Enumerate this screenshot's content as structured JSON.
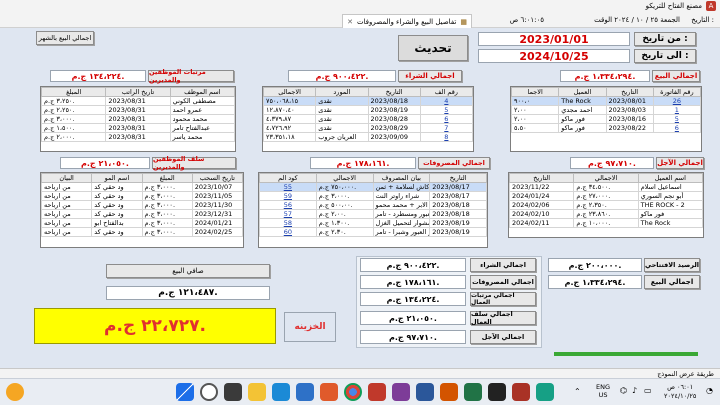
{
  "window": {
    "title": "مصنع الفتاح للتريكو"
  },
  "toolbar": {
    "meta_label": "التاريخ :",
    "date_line": "الجمعة ٢٥ / ١٠ / ٢٠٢٤ الوقت",
    "time": "٦:٠١:٠٥ ص",
    "tab_label": "تفاصيل البيع والشراء والمصروفات"
  },
  "header": {
    "from_label": "من تاريخ :",
    "from_date": "2023/01/01",
    "to_label": "الى تاريخ :",
    "to_date": "2024/10/25",
    "refresh_button": "تحديث",
    "report_button": "اجمالي البيع بالشهر"
  },
  "sales": {
    "label": "اجمالي البيع",
    "total": "١،٣٣٤،٢٩٤ ج.م.",
    "columns": [
      "رقم الفاتورة",
      "التاريخ",
      "العميل",
      "الاجما"
    ],
    "rows": [
      [
        "26",
        "2023/08/01",
        "The Rock",
        "٩٠٠،٠"
      ],
      [
        "1",
        "2023/08/03",
        "احمد مجدي",
        "٢،٠٠"
      ],
      [
        "5",
        "2023/08/16",
        "فور ماكو",
        "٢،٠٠"
      ],
      [
        "6",
        "2023/08/22",
        "فور ماكو",
        "٥،٥٠"
      ]
    ]
  },
  "purchases": {
    "label": "اجمالي الشراء",
    "total": "٩٠٠،٤٢٢ ج.م.",
    "columns": [
      "رقم الف",
      "التاريخ",
      "المورد",
      "الاجمالى"
    ],
    "rows": [
      [
        "4",
        "2023/08/18",
        "نقدى",
        "٧٥٠،٠٦٨،١٥"
      ],
      [
        "5",
        "2023/08/19",
        "نقدى",
        "١٢،٨٧٠،٤٠"
      ],
      [
        "6",
        "2023/08/28",
        "نقدى",
        "٤،٣٧٩،٨٧"
      ],
      [
        "7",
        "2023/08/29",
        "نقدى",
        "٤،٧٢٦،٩٢"
      ],
      [
        "8",
        "2023/09/09",
        "العريان جروب",
        "٢٣،٣٥١،١٨"
      ]
    ]
  },
  "salaries": {
    "label": "مرتبات الموظفين والمديرين",
    "total": "١٣٤،٢٢٤ ج.م.",
    "columns": [
      "اسم الموظف",
      "تاريخ الراتب",
      "المبلغ"
    ],
    "rows": [
      [
        "مصطفى الكوني",
        "2023/08/31",
        "٣،٢٥٠ ج.م."
      ],
      [
        "عمرو احمد",
        "2023/08/31",
        "٢،٢٥٠ ج.م."
      ],
      [
        "محمد محمود",
        "2023/08/31",
        "٣،٠٠٠ ج.م."
      ],
      [
        "عبدالفتاح تامر",
        "2023/08/31",
        "١،٥٠٠ ج.م."
      ],
      [
        "محمد ياسر",
        "2023/08/31",
        "٢،٠٠٠ ج.م."
      ]
    ]
  },
  "credit": {
    "label": "اجمالي الآجل",
    "total": "٩٧،٧١٠ ج.م.",
    "columns": [
      "اسم العميل",
      "الاجمالي",
      "التاريخ"
    ],
    "rows": [
      [
        "اسماعيل اسلام",
        "٣٤،٥٠٠ ج.م.",
        "2023/11/22"
      ],
      [
        "أبو نجم السوري",
        "٢٧،٠٠٠ ج.م.",
        "2024/01/24"
      ],
      [
        "THE ROCK - 2",
        "٢،٣٥٠ ج.م.",
        "2024/02/06"
      ],
      [
        "فور ماكو",
        "٢٣،٨٦٠ ج.م.",
        "2024/02/10"
      ],
      [
        "The Rock",
        "١٠،٠٠٠ ج.م.",
        "2024/02/11"
      ]
    ]
  },
  "expenses": {
    "label": "اجمالي المصروفات",
    "total": "١٧٨،١٦١ ج.م.",
    "columns": [
      "التاريخ",
      "بيان المصروف",
      "الاجمالي",
      "كود الم"
    ],
    "rows": [
      [
        "2023/08/17",
        "نقل فودافون كاش لسلامة + ثمن",
        "٧٥٠،٠٠٠ ج.م.",
        "55"
      ],
      [
        "2023/08/17",
        "شراء راوتر النت",
        "٣،٠٠٠ ج.م.",
        "59"
      ],
      [
        "2023/08/18",
        "اصلاحات تجيب الابر + محمد محمو",
        "٥٠٠،٠٠ ج.م.",
        "56"
      ],
      [
        "2023/08/18",
        "مشوار العبور ومسطرد - تامر",
        "٢،٠٠ ج.م.",
        "57"
      ],
      [
        "2023/08/19",
        "مشوار لتحميل الغزل",
        "١،٣٠٠ ج.م.",
        "58"
      ],
      [
        "2023/08/19",
        "مشوار العبور وشبرا - تامر",
        "٢،٣٠ ج.م.",
        "60"
      ]
    ]
  },
  "advances": {
    "label": "سلف الموظفين والمديرين",
    "total": "٢١،٠٥٠ ج.م.",
    "columns": [
      "تاريخ السحب",
      "المبلغ",
      "اسم المو",
      "البيان"
    ],
    "rows": [
      [
        "2023/10/07",
        "٣،٠٠٠ ج.م.",
        "ود حقي كد",
        "من ارباحه"
      ],
      [
        "2023/11/05",
        "٣،٠٠٠ ج.م.",
        "ود حقي كد",
        "من ارباحه"
      ],
      [
        "2023/11/30",
        "٣،٠٠٠ ج.م.",
        "ود حقي كد",
        "من ارباحه"
      ],
      [
        "2023/12/31",
        "٣،٠٠٠ ج.م.",
        "ود حقي كد",
        "من ارباحه"
      ],
      [
        "2024/01/21",
        "٣،٠٠٠ ج.م.",
        "بدالفتاح ابو",
        "من ارباحه"
      ],
      [
        "2024/02/25",
        "٣،٠٠٠ ج.م.",
        "ود حقي كد",
        "من ارباحه"
      ]
    ]
  },
  "summary": {
    "purchases_label": "اجمالي الشراء",
    "purchases_value": "٩٠٠،٤٢٢ ج.م.",
    "expenses_label": "اجمالي المصروفات",
    "expenses_value": "١٧٨،١٦١ ج.م.",
    "salaries_label": "اجمالي مرتبات العمال",
    "salaries_value": "١٣٤،٢٢٤ ج.م.",
    "advances_label": "اجمالي سلف العمال",
    "advances_value": "٢١،٠٥٠ ج.م.",
    "credit_label": "اجمالي الآجل",
    "credit_value": "٩٧،٧١٠ ج.م.",
    "opening_label": "الرصيد الافتتاحي",
    "opening_value": "٢٠٠،٠٠٠ ج.م.",
    "sales_label": "اجمالي البيع",
    "sales_value": "١،٣٣٤،٢٩٤ ج.م.",
    "net_label": "صافي البيع",
    "net_value": "١٢١،٤٨٧ ج.م.",
    "treasury_label": "الخزينه",
    "treasury_value": "٢٢،٧٢٧ ج.م."
  },
  "status": {
    "text": "طريقة عرض النموذج"
  },
  "taskbar": {
    "lang": "ENG",
    "region": "US",
    "clock_time": "٠٦:٠١ ص",
    "clock_date": "٢٠٢٤/١٠/٢٥"
  },
  "colors": {
    "accent_red": "#d40000",
    "workspace": "#dfe6f1",
    "treasury_yellow": "#ffff00",
    "treasury_text": "#e03030"
  }
}
